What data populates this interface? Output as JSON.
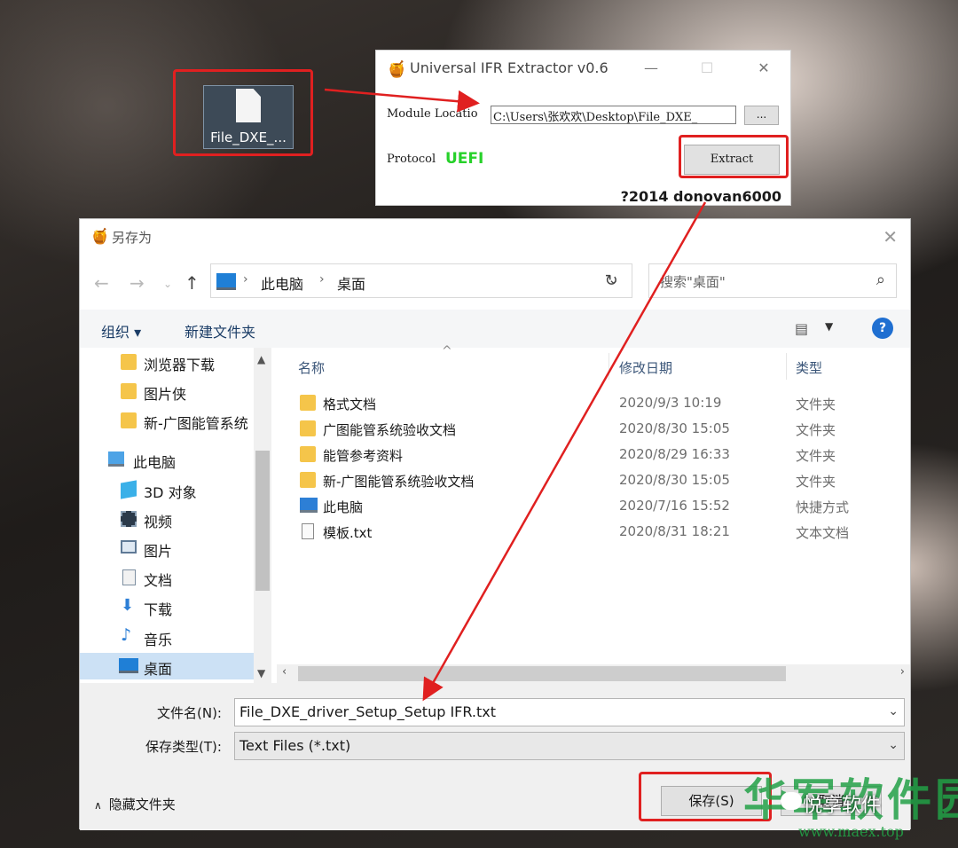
{
  "desktop": {
    "file_label": "File_DXE_..."
  },
  "extractor": {
    "title": "Universal IFR Extractor v0.6",
    "minimize": "—",
    "maximize": "☐",
    "close": "✕",
    "module_label": "Module Locatio",
    "module_path": "C:\\Users\\张欢欢\\Desktop\\File_DXE_",
    "browse_label": "...",
    "protocol_label": "Protocol",
    "protocol_value": "UEFI",
    "extract_label": "Extract",
    "credit": "?2014 donovan6000"
  },
  "dialog": {
    "title": "另存为",
    "breadcrumb": [
      "此电脑",
      "桌面"
    ],
    "search_placeholder": "搜索\"桌面\"",
    "commands": {
      "organize": "组织 ▾",
      "new_folder": "新建文件夹"
    },
    "tree": [
      {
        "label": "浏览器下载",
        "icon": "folder-icon"
      },
      {
        "label": "图片侠",
        "icon": "folder-icon"
      },
      {
        "label": "新-广图能管系统",
        "icon": "folder-icon"
      },
      {
        "label": "此电脑",
        "icon": "computer-icon"
      },
      {
        "label": "3D 对象",
        "icon": "3d-objects-icon"
      },
      {
        "label": "视频",
        "icon": "video-icon"
      },
      {
        "label": "图片",
        "icon": "pictures-icon"
      },
      {
        "label": "文档",
        "icon": "documents-icon"
      },
      {
        "label": "下载",
        "icon": "download-icon"
      },
      {
        "label": "音乐",
        "icon": "music-icon"
      },
      {
        "label": "桌面",
        "icon": "desktop-icon"
      }
    ],
    "columns": {
      "name": "名称",
      "date": "修改日期",
      "type": "类型"
    },
    "files": [
      {
        "name": "格式文档",
        "date": "2020/9/3 10:19",
        "type": "文件夹",
        "icon": "folder-icon"
      },
      {
        "name": "广图能管系统验收文档",
        "date": "2020/8/30 15:05",
        "type": "文件夹",
        "icon": "folder-icon"
      },
      {
        "name": "能管参考资料",
        "date": "2020/8/29 16:33",
        "type": "文件夹",
        "icon": "folder-icon"
      },
      {
        "name": "新-广图能管系统验收文档",
        "date": "2020/8/30 15:05",
        "type": "文件夹",
        "icon": "folder-icon"
      },
      {
        "name": "此电脑",
        "date": "2020/7/16 15:52",
        "type": "快捷方式",
        "icon": "shortcut-icon"
      },
      {
        "name": "模板.txt",
        "date": "2020/8/31 18:21",
        "type": "文本文档",
        "icon": "text-file-icon"
      }
    ],
    "filename_label": "文件名(N):",
    "filename_value": "File_DXE_driver_Setup_Setup IFR.txt",
    "filetype_label": "保存类型(T):",
    "filetype_value": "Text Files (*.txt)",
    "hide_folders": "隐藏文件夹",
    "save_label": "保存(S)",
    "cancel_label": "取消"
  },
  "watermark": {
    "big": "华军软件园",
    "sub": "悦享软件",
    "url": "www.maex.top"
  },
  "colors": {
    "annotation_red": "#e02020",
    "protocol_green": "#27d12a",
    "selection": "#cce1f5"
  }
}
